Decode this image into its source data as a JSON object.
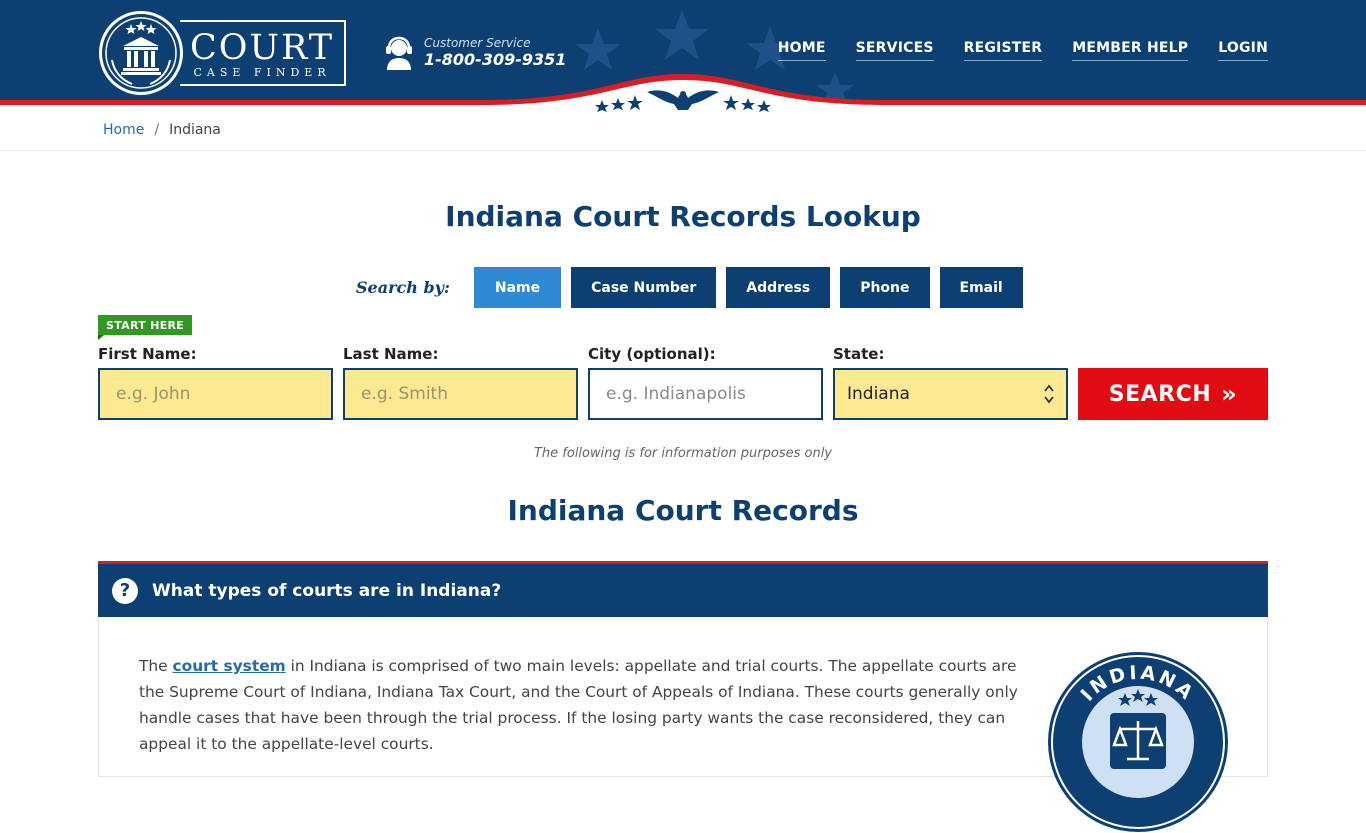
{
  "header": {
    "logo": {
      "word": "COURT",
      "sub": "CASE FINDER"
    },
    "customer_service": {
      "label": "Customer Service",
      "phone": "1-800-309-9351"
    },
    "nav": [
      {
        "label": "HOME"
      },
      {
        "label": "SERVICES"
      },
      {
        "label": "REGISTER"
      },
      {
        "label": "MEMBER HELP"
      },
      {
        "label": "LOGIN"
      }
    ]
  },
  "breadcrumb": {
    "home": "Home",
    "separator": "/",
    "current": "Indiana"
  },
  "page_title": "Indiana Court Records Lookup",
  "search_by": {
    "label": "Search by:",
    "tabs": [
      {
        "label": "Name",
        "active": true
      },
      {
        "label": "Case Number",
        "active": false
      },
      {
        "label": "Address",
        "active": false
      },
      {
        "label": "Phone",
        "active": false
      },
      {
        "label": "Email",
        "active": false
      }
    ]
  },
  "form": {
    "badge": "START HERE",
    "first_name": {
      "label": "First Name:",
      "placeholder": "e.g. John"
    },
    "last_name": {
      "label": "Last Name:",
      "placeholder": "e.g. Smith"
    },
    "city": {
      "label": "City (optional):",
      "placeholder": "e.g.  Indianapolis"
    },
    "state": {
      "label": "State:",
      "value": "Indiana"
    },
    "search_button": "SEARCH",
    "search_button_icon": "»"
  },
  "disclaimer": "The following is for information purposes only",
  "section_title": "Indiana Court Records",
  "accordion": {
    "icon": "?",
    "title": "What types of courts are in Indiana?",
    "text_before_link": "The ",
    "link": "court system",
    "text_after_link": " in Indiana is comprised of two main levels: appellate and trial courts. The appellate courts are the Supreme Court of Indiana, Indiana Tax Court, and the Court of Appeals of Indiana. These courts generally only handle cases that have been through the trial process. If the losing party wants the case reconsidered, they can appeal it to the appellate-level courts.",
    "seal_text": "INDIANA"
  },
  "colors": {
    "navy": "#0d3f73",
    "active_tab": "#2f8ad6",
    "search_red": "#e00c12",
    "input_yellow": "#fde992",
    "badge_green": "#2f9a1f",
    "accent_red": "#d81e25"
  }
}
